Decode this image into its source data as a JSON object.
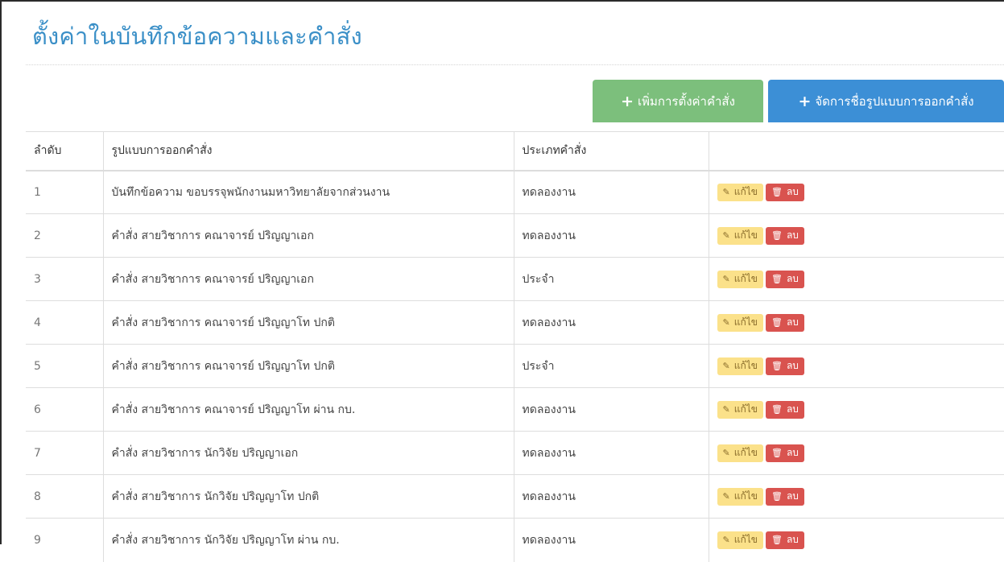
{
  "page": {
    "title": "ตั้งค่าในบันทึกข้อความและคำสั่ง"
  },
  "toolbar": {
    "add_setting_label": "เพิ่มการตั้งค่าคำสั่ง",
    "manage_forms_label": "จัดการชื่อรูปแบบการออกคำสั่ง",
    "add_icon": "plus-icon",
    "green": "#7cbf7c",
    "blue": "#3c8fd6"
  },
  "table": {
    "headers": [
      "ลำดับ",
      "รูปแบบการออกคำสั่ง",
      "ประเภทคำสั่ง",
      ""
    ],
    "edit_label": "แก้ไข",
    "delete_label": "ลบ",
    "edit_icon": "pencil-icon",
    "delete_icon": "trash-icon",
    "rows": [
      {
        "no": "1",
        "form": "บันทึกข้อความ ขอบรรจุพนักงานมหาวิทยาลัยจากส่วนงาน",
        "type": "ทดลองงาน"
      },
      {
        "no": "2",
        "form": "คำสั่ง สายวิชาการ คณาจารย์ ปริญญาเอก",
        "type": "ทดลองงาน"
      },
      {
        "no": "3",
        "form": "คำสั่ง สายวิชาการ คณาจารย์ ปริญญาเอก",
        "type": "ประจำ"
      },
      {
        "no": "4",
        "form": "คำสั่ง สายวิชาการ คณาจารย์ ปริญญาโท ปกติ",
        "type": "ทดลองงาน"
      },
      {
        "no": "5",
        "form": "คำสั่ง สายวิชาการ คณาจารย์ ปริญญาโท ปกติ",
        "type": "ประจำ"
      },
      {
        "no": "6",
        "form": "คำสั่ง สายวิชาการ คณาจารย์ ปริญญาโท ผ่าน กบ.",
        "type": "ทดลองงาน"
      },
      {
        "no": "7",
        "form": "คำสั่ง สายวิชาการ นักวิจัย ปริญญาเอก",
        "type": "ทดลองงาน"
      },
      {
        "no": "8",
        "form": "คำสั่ง สายวิชาการ นักวิจัย ปริญญาโท ปกติ",
        "type": "ทดลองงาน"
      },
      {
        "no": "9",
        "form": "คำสั่ง สายวิชาการ นักวิจัย ปริญญาโท ผ่าน กบ.",
        "type": "ทดลองงาน"
      }
    ]
  }
}
